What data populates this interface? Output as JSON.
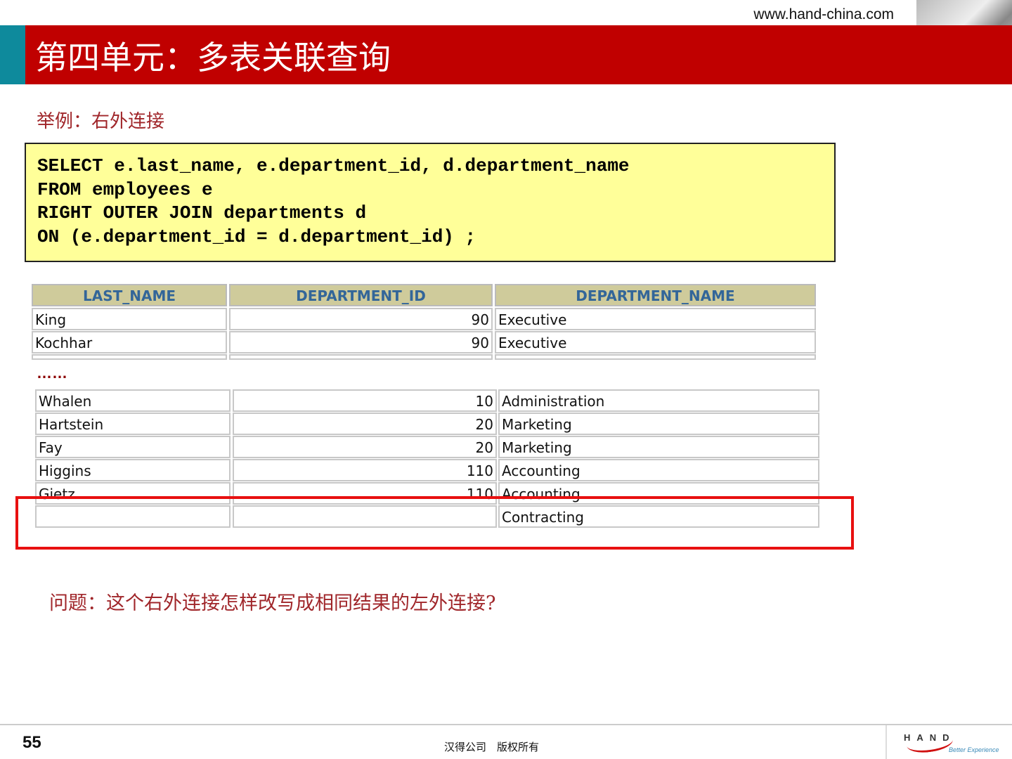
{
  "header": {
    "url": "www.hand-china.com",
    "title": "第四单元：多表关联查询"
  },
  "subtitle": "举例：右外连接",
  "code": [
    "SELECT e.last_name, e.department_id, d.department_name",
    "FROM employees e",
    "RIGHT OUTER JOIN departments d",
    "ON (e.department_id = d.department_id) ;"
  ],
  "table": {
    "headers": [
      "LAST_NAME",
      "DEPARTMENT_ID",
      "DEPARTMENT_NAME"
    ],
    "rows_top": [
      [
        "King",
        "90",
        "Executive"
      ],
      [
        "Kochhar",
        "90",
        "Executive"
      ]
    ],
    "ellipsis": "……",
    "rows_bottom": [
      [
        "Whalen",
        "10",
        "Administration"
      ],
      [
        "Hartstein",
        "20",
        "Marketing"
      ],
      [
        "Fay",
        "20",
        "Marketing"
      ],
      [
        "Higgins",
        "110",
        "Accounting"
      ],
      [
        "Gietz",
        "110",
        "Accounting"
      ],
      [
        "",
        "",
        "Contracting"
      ]
    ]
  },
  "question": "问题：这个右外连接怎样改写成相同结果的左外连接?",
  "footer": {
    "page": "55",
    "copyright": "汉得公司　版权所有",
    "logo_text": "HAND",
    "logo_tagline": "Better Experience"
  }
}
